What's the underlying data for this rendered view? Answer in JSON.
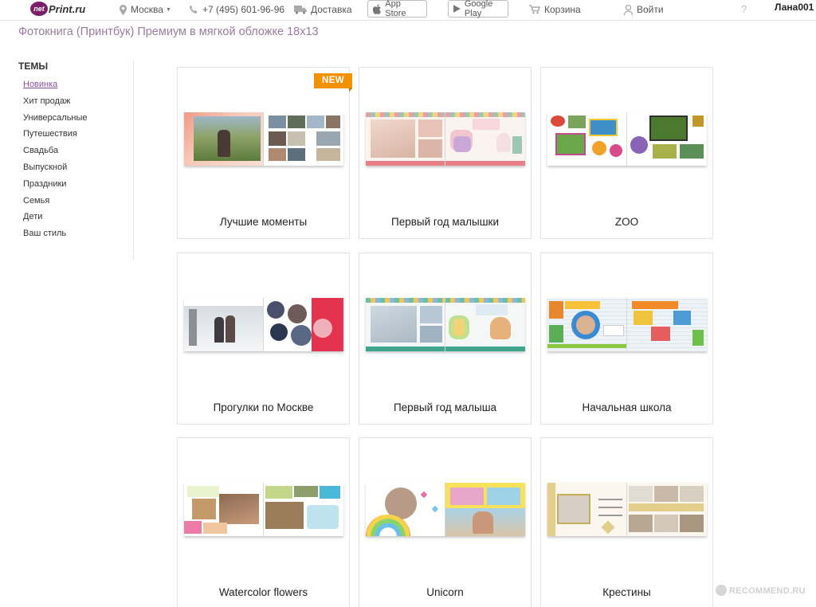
{
  "header": {
    "logo_net": "net",
    "logo_rest": "Print.ru",
    "city": "Москва",
    "phone": "+7 (495) 601-96-96",
    "delivery": "Доставка",
    "app_store": "App Store",
    "google_play": "Google Play",
    "cart": "Корзина",
    "login": "Войти",
    "help": "?",
    "user": "Лана001"
  },
  "page_title": "Фотокнига (Принтбук) Премиум в мягкой обложке 18x13",
  "sidebar": {
    "heading": "ТЕМЫ",
    "items": [
      {
        "label": "Новинка"
      },
      {
        "label": "Хит продаж"
      },
      {
        "label": "Универсальные"
      },
      {
        "label": "Путешествия"
      },
      {
        "label": "Свадьба"
      },
      {
        "label": "Выпускной"
      },
      {
        "label": "Праздники"
      },
      {
        "label": "Семья"
      },
      {
        "label": "Дети"
      },
      {
        "label": "Ваш стиль"
      }
    ]
  },
  "products": [
    {
      "title": "Лучшие моменты",
      "badge": "NEW"
    },
    {
      "title": "Первый год малышки"
    },
    {
      "title": "ZOO"
    },
    {
      "title": "Прогулки по Москве"
    },
    {
      "title": "Первый год малыша"
    },
    {
      "title": "Начальная школа"
    },
    {
      "title": "Watercolor flowers"
    },
    {
      "title": "Unicorn"
    },
    {
      "title": "Крестины"
    }
  ],
  "watermark": "RECOMMEND.RU",
  "colors": {
    "accent": "#8a4f9a",
    "title": "#9a7aa0",
    "badge": "#f39200",
    "logo": "#7a1f68"
  }
}
